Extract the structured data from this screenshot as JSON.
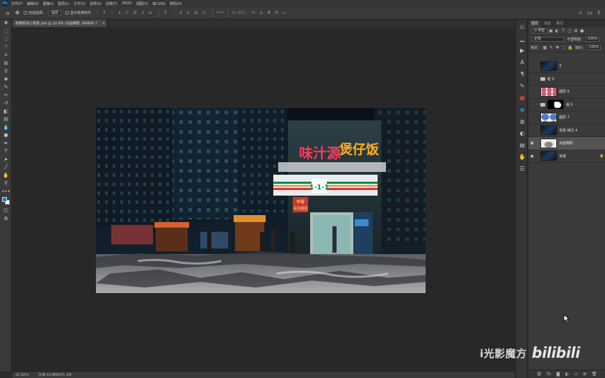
{
  "app": {
    "logo": "Ps"
  },
  "menu": [
    "文件(F)",
    "编辑(E)",
    "图像(I)",
    "图层(L)",
    "文字(Y)",
    "选择(S)",
    "滤镜(T)",
    "3D(D)",
    "视图(V)",
    "窗口(W)",
    "帮助(H)"
  ],
  "options_bar": {
    "auto_select_label": "自动选择：",
    "auto_select_value": "图层",
    "show_transform_label": "显示变换控件",
    "mode_3d_label": "3D 模式："
  },
  "document": {
    "tab_label": "夜晚街道小场景.psb @ 22.9% (水面倒影, RGB/8) *",
    "close_symbol": "×"
  },
  "status": {
    "zoom": "22.92%",
    "doc_size": "文档:33.8M/671.1M"
  },
  "photo": {
    "sign_main": "味汁源",
    "sign_side": "煲仔饭",
    "store_logo": "1·1·1",
    "store_logo_colors": [
      "#e23b2f",
      "#0d8f46",
      "#f08a1d"
    ],
    "small_sign_1": "早餐",
    "small_sign_2": "百货烟酒"
  },
  "layers_panel": {
    "tabs": [
      "图层",
      "通道",
      "路径"
    ],
    "filter_label": "Q 类型",
    "blend_mode": "正常",
    "opacity_label": "不透明度：",
    "opacity_value": "100%",
    "lock_label": "锁定：",
    "fill_label": "填充：",
    "fill_value": "100%",
    "layers": [
      {
        "name": "3",
        "thumb": "dark",
        "visible": false,
        "selected": false,
        "kind": "layer",
        "lock": ""
      },
      {
        "name": "组 3",
        "thumb": "",
        "visible": false,
        "selected": false,
        "kind": "group",
        "lock": ""
      },
      {
        "name": "图层 6",
        "thumb": "checker-red",
        "visible": false,
        "selected": false,
        "kind": "layer",
        "lock": ""
      },
      {
        "name": "组 5",
        "thumb": "",
        "visible": false,
        "selected": false,
        "kind": "group-mask",
        "lock": ""
      },
      {
        "name": "图层 7",
        "thumb": "checker-blue",
        "visible": false,
        "selected": false,
        "kind": "layer",
        "lock": ""
      },
      {
        "name": "背景 拷贝 4",
        "thumb": "dark",
        "visible": false,
        "selected": false,
        "kind": "layer",
        "lock": ""
      },
      {
        "name": "水面倒影",
        "thumb": "checker-grey",
        "visible": true,
        "selected": true,
        "kind": "layer",
        "lock": ""
      },
      {
        "name": "背景",
        "thumb": "dark",
        "visible": true,
        "selected": false,
        "kind": "layer",
        "lock": "🔒"
      }
    ]
  },
  "watermark": {
    "text": "i光影魔方",
    "logo": "bilibili"
  }
}
